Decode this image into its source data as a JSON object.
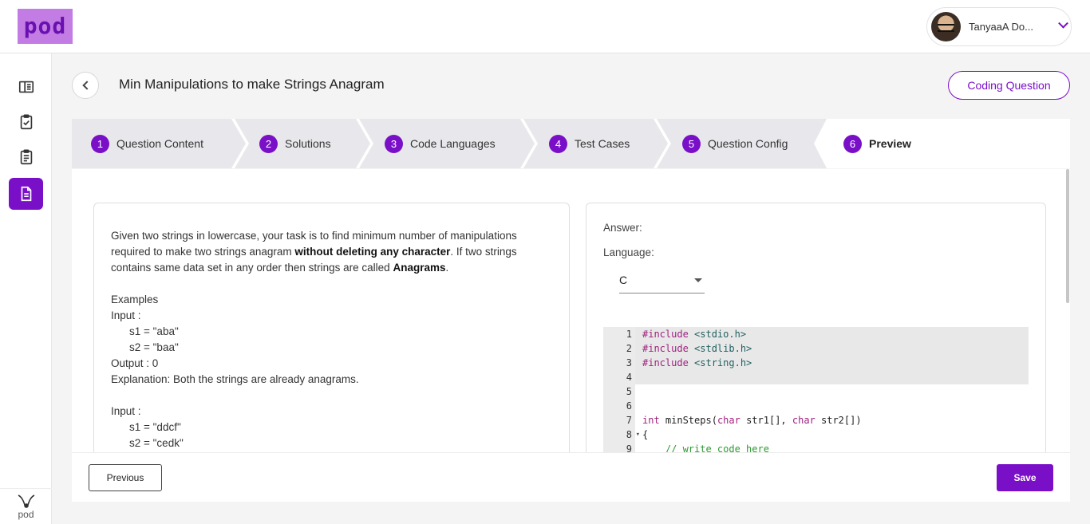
{
  "header": {
    "logo_text": "pod",
    "user_name": "TanyaaA Do..."
  },
  "nav": {
    "items": [
      {
        "icon": "book-open-icon"
      },
      {
        "icon": "clipboard-check-icon"
      },
      {
        "icon": "clipboard-list-icon"
      },
      {
        "icon": "document-icon",
        "active": true
      }
    ],
    "bottom_logo_text": "pod"
  },
  "page": {
    "title": "Min Manipulations to make Strings Anagram",
    "type_label": "Coding Question"
  },
  "steps": [
    {
      "num": "1",
      "label": "Question Content"
    },
    {
      "num": "2",
      "label": "Solutions"
    },
    {
      "num": "3",
      "label": "Code Languages"
    },
    {
      "num": "4",
      "label": "Test Cases"
    },
    {
      "num": "5",
      "label": "Question Config"
    },
    {
      "num": "6",
      "label": "Preview"
    }
  ],
  "question": {
    "p1_a": "Given two strings in lowercase, your task is to find minimum number of manipulations required to make two strings anagram ",
    "p1_bold": "without deleting any character",
    "p1_b": ". If two strings contains same data set in any order then strings are called ",
    "p1_bold2": "Anagrams",
    "p1_c": ".",
    "examples": "Examples",
    "ex1_input": "Input :",
    "ex1_s1": "s1 = \"aba\"",
    "ex1_s2": "s2 = \"baa\"",
    "ex1_output": "Output : 0",
    "ex1_expl": "Explanation: Both the strings are already anagrams.",
    "ex2_input": "Input :",
    "ex2_s1": "s1 = \"ddcf\"",
    "ex2_s2": "s2 = \"cedk\""
  },
  "answer": {
    "label": "Answer:",
    "language_label": "Language:",
    "language_value": "C",
    "code": [
      {
        "n": "1",
        "kw": "#include",
        "rest": " <stdio.h>"
      },
      {
        "n": "2",
        "kw": "#include",
        "rest": " <stdlib.h>"
      },
      {
        "n": "3",
        "kw": "#include",
        "rest": " <string.h>"
      },
      {
        "n": "4",
        "kw": "",
        "rest": ""
      },
      {
        "n": "5",
        "kw": "",
        "rest": ""
      },
      {
        "n": "6",
        "kw": "",
        "rest": ""
      },
      {
        "n": "7",
        "kw": "int",
        "rest": " minSteps(",
        "kw2": "char",
        "rest2": " str1[], ",
        "kw3": "char",
        "rest3": " str2[])"
      },
      {
        "n": "8",
        "kw": "",
        "rest": "{"
      },
      {
        "n": "9",
        "kw": "",
        "rest": "    // write code here"
      }
    ]
  },
  "footer": {
    "previous_label": "Previous",
    "save_label": "Save"
  },
  "colors": {
    "accent": "#7a0fc8",
    "logo_bg": "#c27ce4"
  }
}
